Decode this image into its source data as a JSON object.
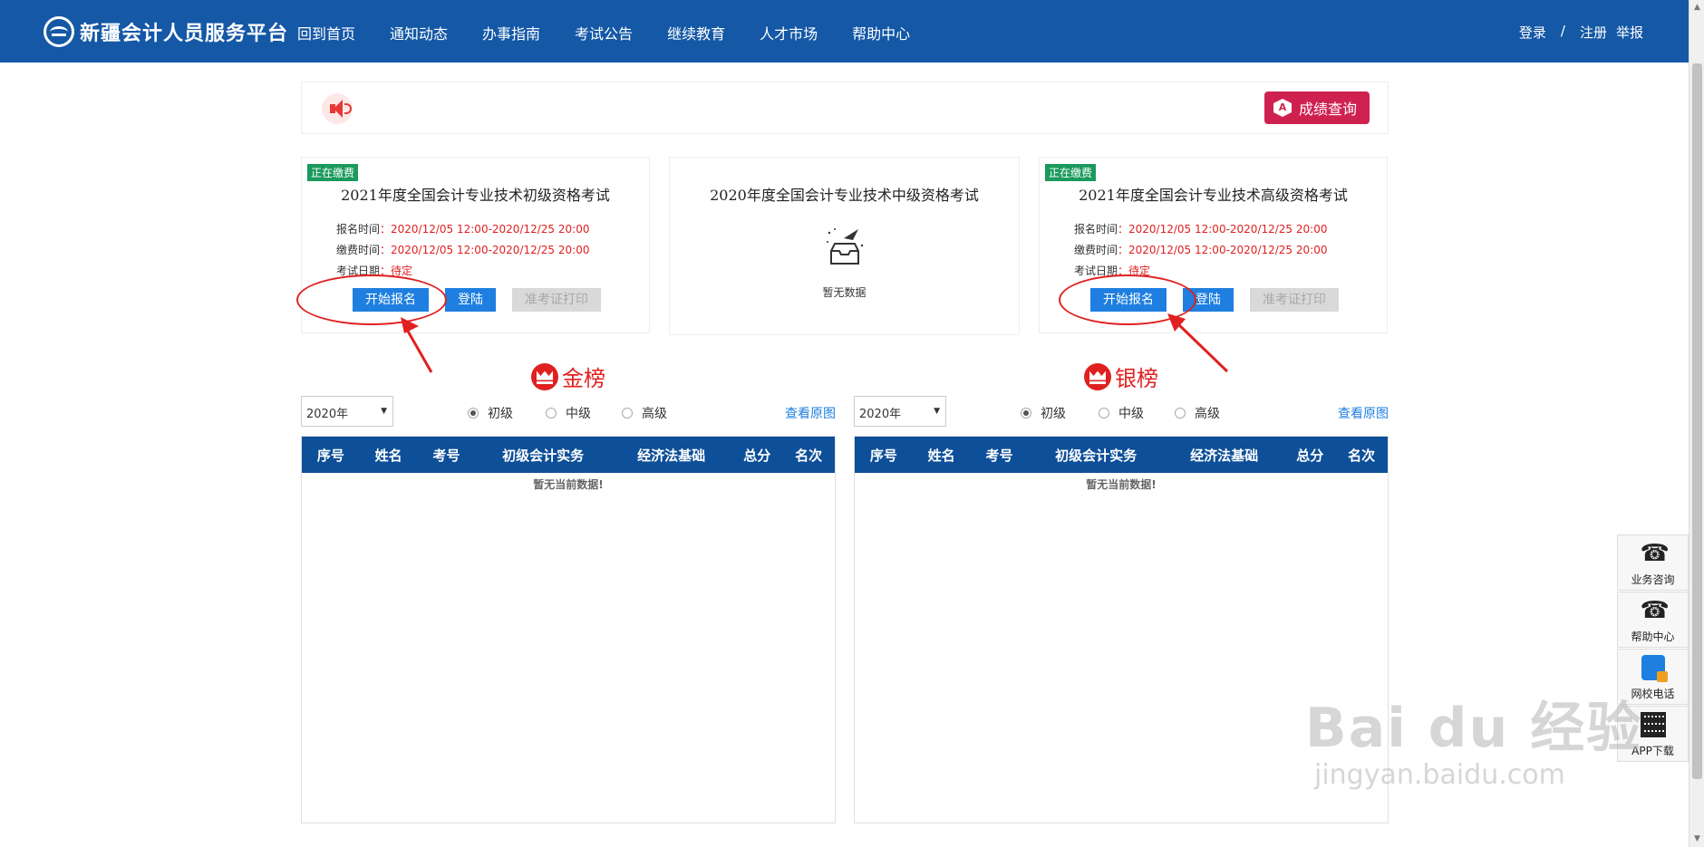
{
  "header": {
    "logo_text": "新疆会计人员服务平台",
    "nav": [
      "回到首页",
      "通知动态",
      "办事指南",
      "考试公告",
      "继续教育",
      "人才市场",
      "帮助中心"
    ],
    "login": "登录",
    "sep": "/",
    "register": "注册",
    "report": "举报",
    "bg_color": "#1458a6"
  },
  "notice": {
    "score_button": "成绩查询",
    "score_icon_letter": "A"
  },
  "cards": [
    {
      "tag": "正在缴费",
      "title": "2021年度全国会计专业技术初级资格考试",
      "reg_label": "报名时间",
      "reg_value": "：2020/12/05 12:00-2020/12/25 20:00",
      "pay_label": "缴费时间",
      "pay_value": "：2020/12/05 12:00-2020/12/25 20:00",
      "exam_label": "考试日期",
      "exam_value": "：待定",
      "btn_start": "开始报名",
      "btn_login": "登陆",
      "btn_print": "准考证打印"
    },
    {
      "title": "2020年度全国会计专业技术中级资格考试",
      "nodata": "暂无数据"
    },
    {
      "tag": "正在缴费",
      "title": "2021年度全国会计专业技术高级资格考试",
      "reg_label": "报名时间",
      "reg_value": "：2020/12/05 12:00-2020/12/25 20:00",
      "pay_label": "缴费时间",
      "pay_value": "：2020/12/05 12:00-2020/12/25 20:00",
      "exam_label": "考试日期",
      "exam_value": "：待定",
      "btn_start": "开始报名",
      "btn_login": "登陆",
      "btn_print": "准考证打印"
    }
  ],
  "rankings": [
    {
      "title": "金榜",
      "year": "2020年",
      "levels": [
        "初级",
        "中级",
        "高级"
      ],
      "selected_level": "初级",
      "view_link": "查看原图",
      "columns": [
        "序号",
        "姓名",
        "考号",
        "初级会计实务",
        "经济法基础",
        "总分",
        "名次"
      ],
      "empty": "暂无当前数据!"
    },
    {
      "title": "银榜",
      "year": "2020年",
      "levels": [
        "初级",
        "中级",
        "高级"
      ],
      "selected_level": "初级",
      "view_link": "查看原图",
      "columns": [
        "序号",
        "姓名",
        "考号",
        "初级会计实务",
        "经济法基础",
        "总分",
        "名次"
      ],
      "empty": "暂无当前数据!"
    }
  ],
  "side_panel": [
    {
      "label": "业务咨询",
      "icon": "phone-icon"
    },
    {
      "label": "帮助中心",
      "icon": "phone-icon"
    },
    {
      "label": "网校电话",
      "icon": "mobile-icon"
    },
    {
      "label": "APP下载",
      "icon": "qr-code-icon"
    }
  ],
  "watermark": {
    "main": "Bai du 经验",
    "sub": "jingyan.baidu.com"
  },
  "colors": {
    "primary": "#1e7fe0",
    "danger": "#e02020",
    "score": "#cf2150",
    "tag": "#1a9a5c",
    "table_head": "#0d4f98"
  }
}
